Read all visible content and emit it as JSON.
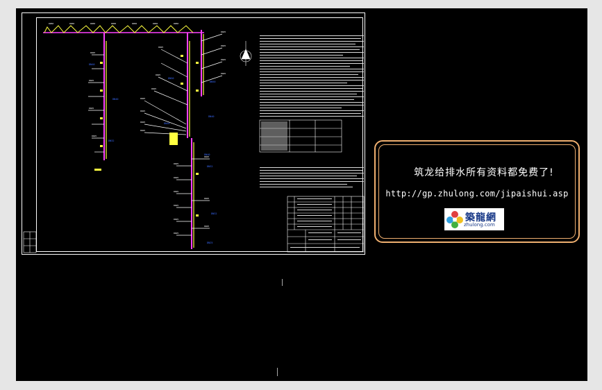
{
  "ad_panel": {
    "title": "筑龙给排水所有资料都免费了!",
    "url": "http://gp.zhulong.com/jipaishui.asp",
    "logo": {
      "name": "築龍網",
      "domain": "zhulong.com"
    }
  },
  "colors": {
    "background": "#000000",
    "frame": "#ffffff",
    "pipe_magenta": "#ff40ff",
    "pipe_yellow": "#ffff40",
    "label_blue": "#3a6cff",
    "panel_border": "#f0b070"
  }
}
